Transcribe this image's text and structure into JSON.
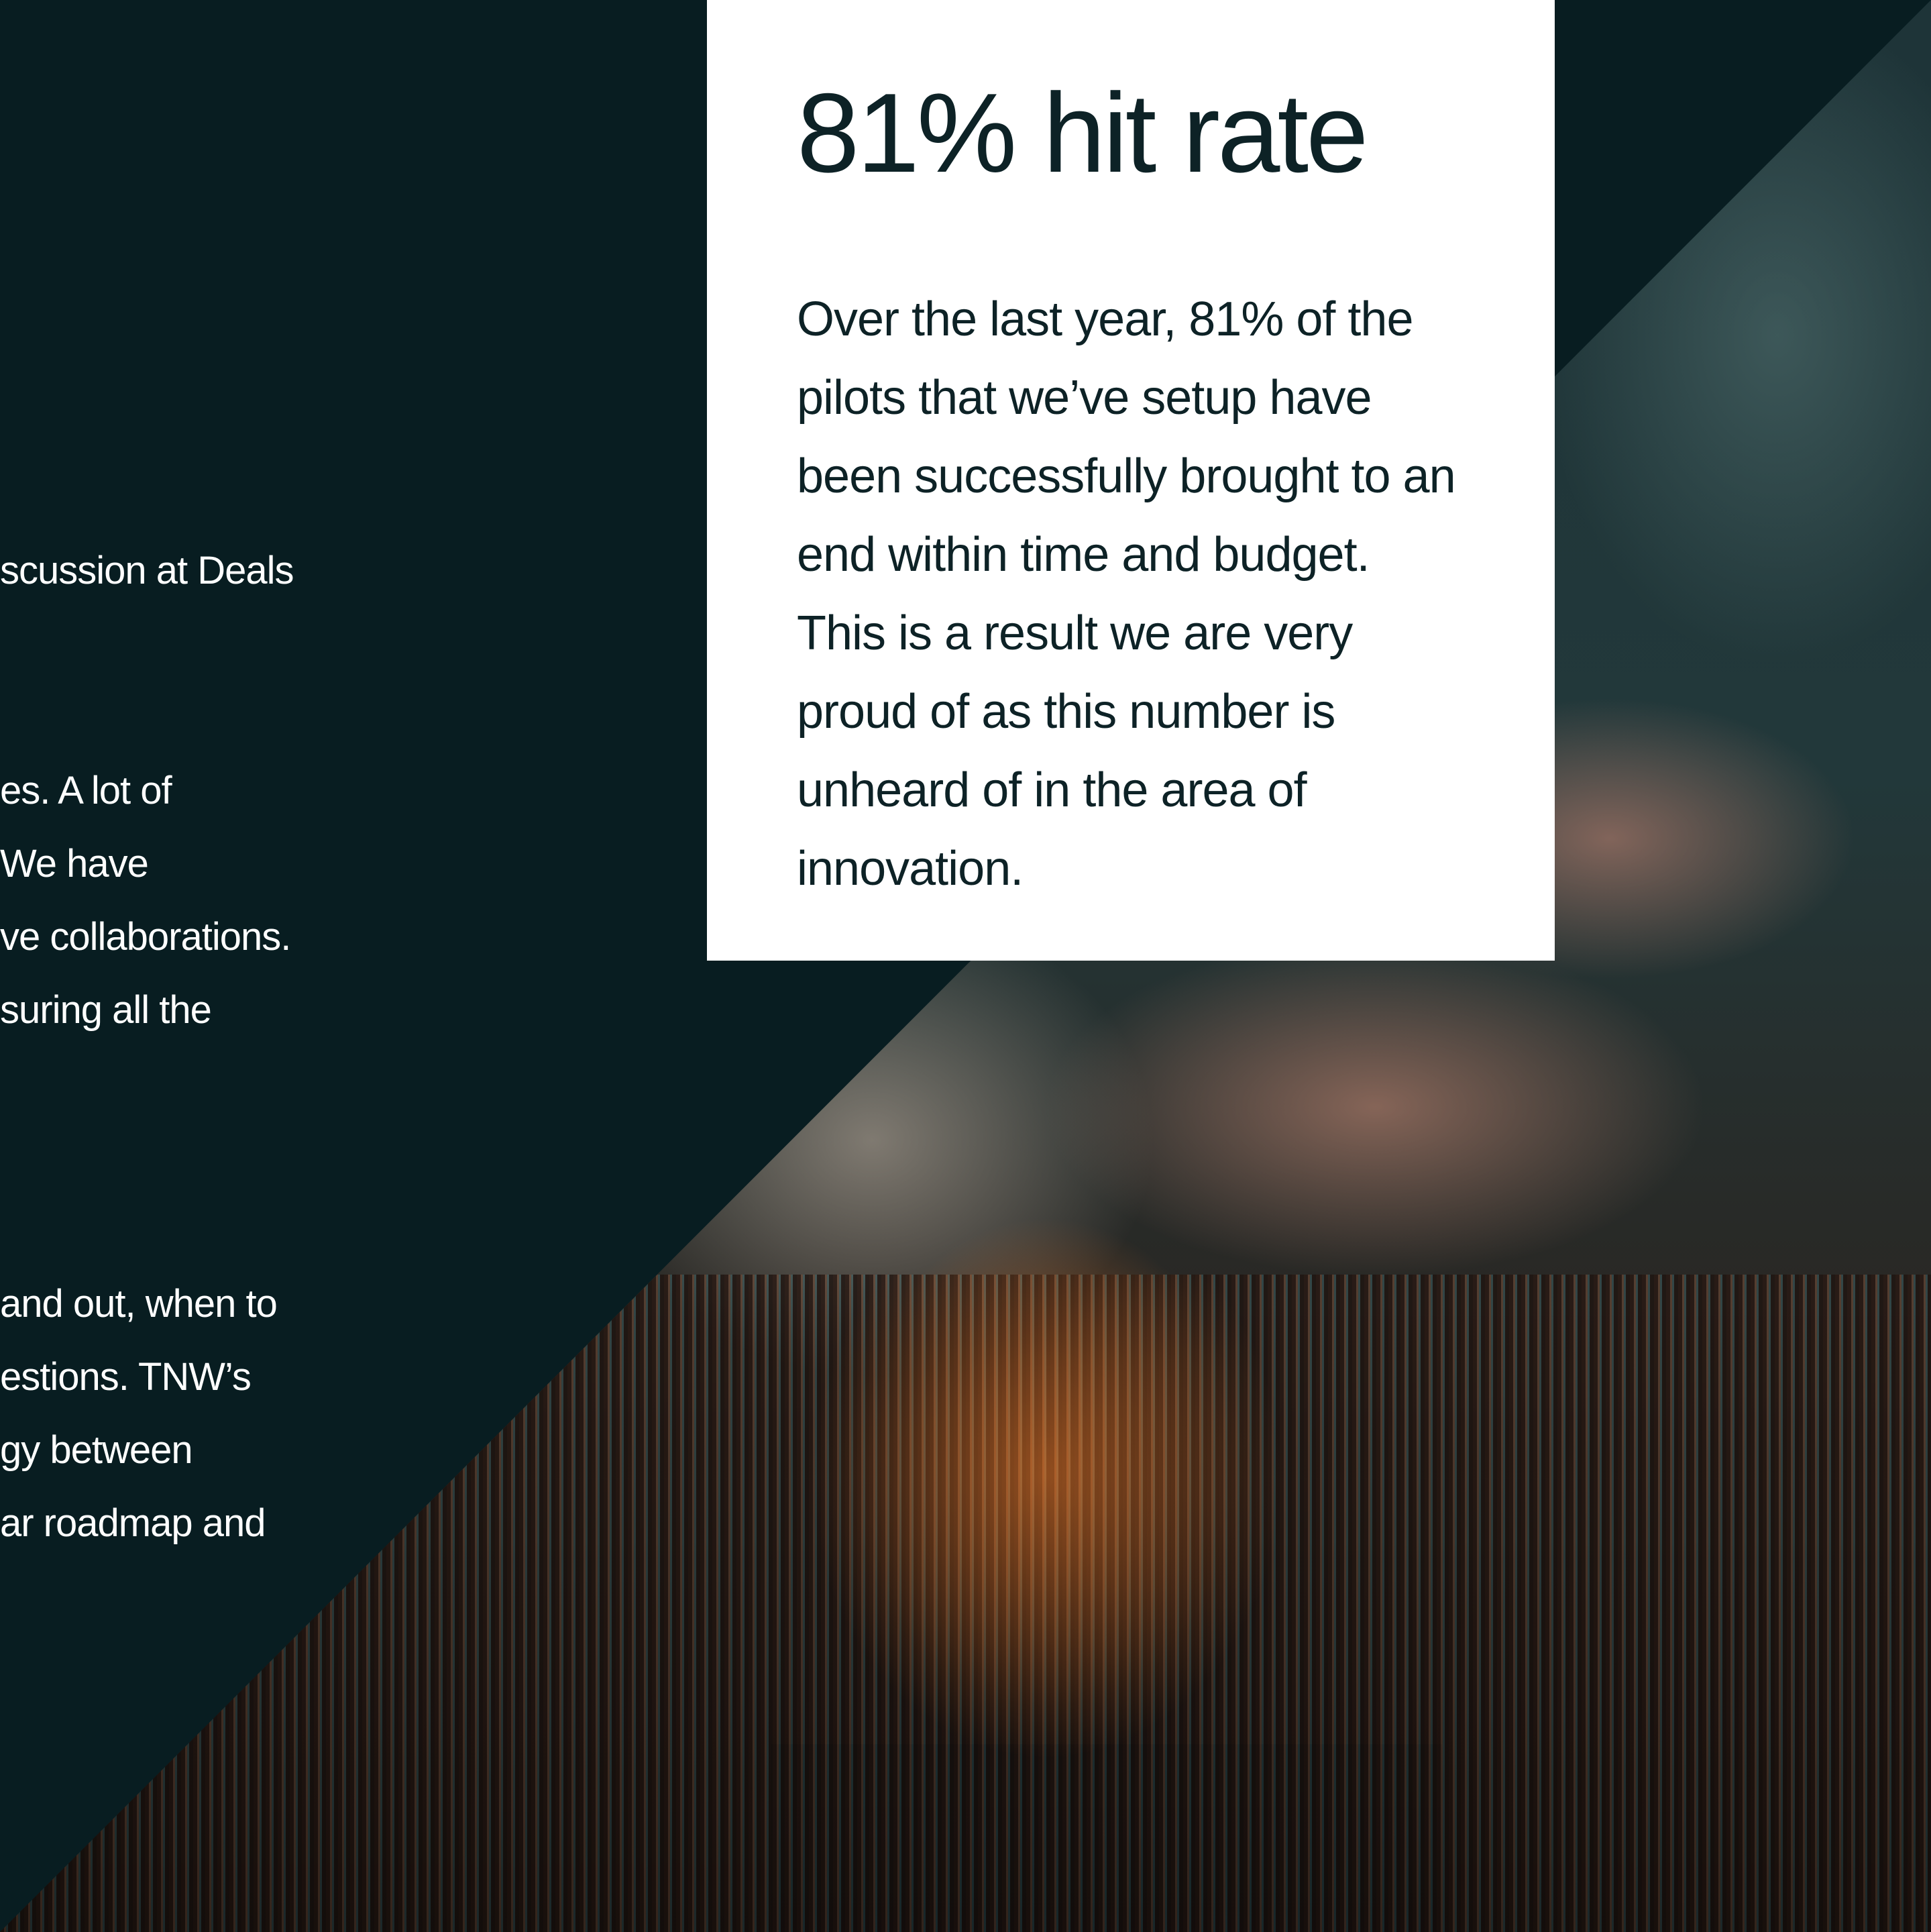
{
  "left_column": {
    "lines": [
      "scussion at Deals",
      "es. A lot of",
      "We have",
      "ve collaborations.",
      "suring all the",
      " and out, when to",
      "estions. TNW’s",
      "gy between",
      "ar roadmap and"
    ]
  },
  "stat_card": {
    "title": "81% hit rate",
    "body_lines": [
      "Over the last year, 81% of the",
      "pilots that we’ve setup have",
      "been successfully brought to an",
      "end within time and budget.",
      "This is a result we are very",
      "proud of as this number is",
      "unheard of in the area of",
      "innovation."
    ]
  },
  "colors": {
    "background": "#081d21",
    "card": "#ffffff",
    "card_text": "#0d2226",
    "left_text": "#ffffff"
  }
}
